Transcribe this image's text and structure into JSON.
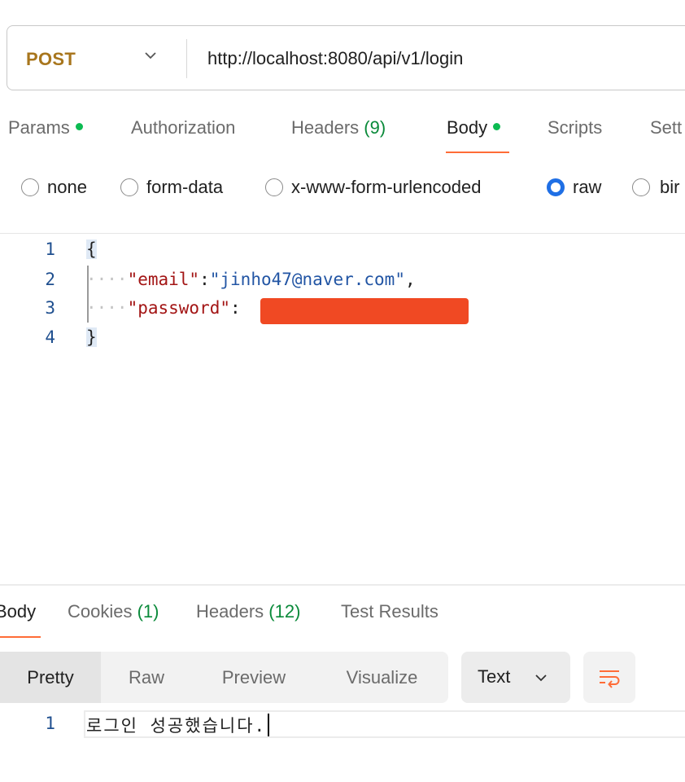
{
  "request": {
    "method": "POST",
    "url": "http://localhost:8080/api/v1/login"
  },
  "request_tabs": [
    {
      "label": "Params",
      "dot": true
    },
    {
      "label": "Authorization"
    },
    {
      "label": "Headers",
      "count": "(9)"
    },
    {
      "label": "Body",
      "dot": true,
      "active": true
    },
    {
      "label": "Scripts"
    },
    {
      "label": "Sett"
    }
  ],
  "body_types": [
    {
      "label": "none",
      "selected": false
    },
    {
      "label": "form-data",
      "selected": false
    },
    {
      "label": "x-www-form-urlencoded",
      "selected": false
    },
    {
      "label": "raw",
      "selected": true
    },
    {
      "label": "bir",
      "selected": false
    }
  ],
  "editor": {
    "line_numbers": [
      "1",
      "2",
      "3",
      "4"
    ],
    "open_brace": "{",
    "close_brace": "}",
    "email_key": "\"email\"",
    "email_value": "\"jinho47@naver.com\"",
    "password_key": "\"password\""
  },
  "response_tabs": [
    {
      "label": "Body",
      "active": true
    },
    {
      "label": "Cookies",
      "count": "(1)"
    },
    {
      "label": "Headers",
      "count": "(12)"
    },
    {
      "label": "Test Results"
    }
  ],
  "format_buttons": [
    "Pretty",
    "Raw",
    "Preview",
    "Visualize"
  ],
  "format_type": "Text",
  "response_body": {
    "line_number": "1",
    "text": "로그인 성공했습니다."
  },
  "colors": {
    "accent": "#ff6c37",
    "method": "#a8761d",
    "status_dot": "#0cbb52",
    "radio_selected": "#1f6fe5"
  }
}
